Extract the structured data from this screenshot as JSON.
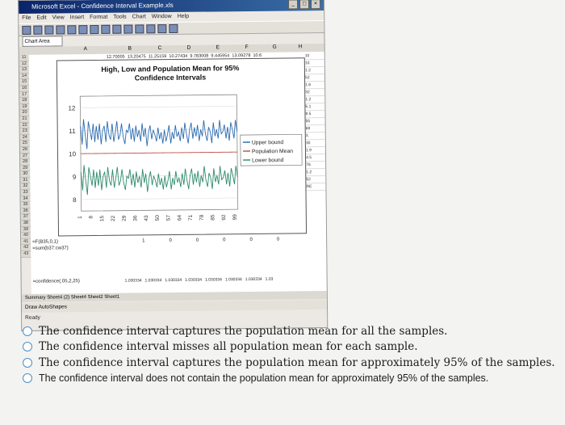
{
  "window": {
    "title": "Microsoft Excel - Confidence Interval Example.xls",
    "menu": [
      "File",
      "Edit",
      "View",
      "Insert",
      "Format",
      "Tools",
      "Chart",
      "Window",
      "Help"
    ],
    "name_box": "Chart Area"
  },
  "sheet": {
    "columns": [
      "A",
      "B",
      "C",
      "D",
      "E",
      "F",
      "G",
      "H"
    ],
    "rows": [
      "11",
      "12",
      "13",
      "14",
      "15",
      "16",
      "17",
      "18",
      "19",
      "20",
      "21",
      "22",
      "23",
      "24",
      "25",
      "26",
      "27",
      "28",
      "29",
      "30",
      "31",
      "32",
      "33",
      "34",
      "35",
      "36",
      "37",
      "38",
      "39",
      "40",
      "41",
      "42",
      "43"
    ],
    "row11_values": [
      "12.70005",
      "13.20475",
      "11.25159",
      "10.27434",
      "9.783008",
      "9.445954",
      "13.09278",
      "10.6"
    ],
    "right_col_values": [
      "10",
      "10.",
      "1.2",
      "52",
      "1.6",
      "32",
      "1.2",
      "5.1",
      "8.5",
      "55",
      "68",
      "3.",
      "30",
      "1.9",
      "4.5",
      "76",
      "1.2",
      "52",
      "RE"
    ],
    "row37": {
      "label": "=F(B35,0,1)",
      "values": [
        "1",
        "0",
        "0",
        "0",
        "0",
        "0"
      ]
    },
    "row38": {
      "label": "=sum(b37:cw37)"
    },
    "row42": {
      "label": "=confidence(.05,2,25)",
      "values": [
        "1.030334",
        "1.030334",
        "1.030334",
        "1.030334",
        "1.030334",
        "1.030334",
        "1.030334",
        "1.03"
      ]
    },
    "tabs": "Summary  Sheet4 (2)  Sheet4  Sheet2  Sheet1",
    "draw_bar": "Draw  AutoShapes",
    "status": "Ready"
  },
  "chart_data": {
    "type": "line",
    "title": "High, Low and Population Mean for 95% Confidence Intervals",
    "xlabel": "",
    "ylabel": "",
    "ylim": [
      7.5,
      12.5
    ],
    "yticks": [
      8,
      9,
      10,
      11,
      12
    ],
    "xticks": [
      "1",
      "8",
      "15",
      "22",
      "29",
      "36",
      "43",
      "50",
      "57",
      "64",
      "71",
      "78",
      "85",
      "92",
      "99"
    ],
    "x": [
      1,
      2,
      3,
      4,
      5,
      6,
      7,
      8,
      9,
      10,
      11,
      12,
      13,
      14,
      15,
      16,
      17,
      18,
      19,
      20,
      21,
      22,
      23,
      24,
      25,
      26,
      27,
      28,
      29,
      30,
      31,
      32,
      33,
      34,
      35,
      36,
      37,
      38,
      39,
      40,
      41,
      42,
      43,
      44,
      45,
      46,
      47,
      48,
      49,
      50,
      51,
      52,
      53,
      54,
      55,
      56,
      57,
      58,
      59,
      60,
      61,
      62,
      63,
      64,
      65,
      66,
      67,
      68,
      69,
      70,
      71,
      72,
      73,
      74,
      75,
      76,
      77,
      78,
      79,
      80,
      81,
      82,
      83,
      84,
      85,
      86,
      87,
      88,
      89,
      90,
      91,
      92,
      93,
      94,
      95,
      96,
      97,
      98,
      99,
      100
    ],
    "series": [
      {
        "name": "Upper bound",
        "color": "#2a6ab0",
        "values": [
          11.2,
          10.4,
          11.5,
          10.8,
          10.2,
          11.4,
          11.0,
          10.6,
          11.3,
          10.5,
          11.2,
          10.6,
          11.3,
          10.4,
          11.0,
          11.2,
          10.5,
          11.4,
          10.8,
          10.6,
          11.3,
          10.5,
          10.9,
          11.4,
          10.6,
          10.8,
          11.3,
          10.7,
          10.4,
          11.0,
          10.9,
          11.3,
          10.6,
          11.1,
          10.5,
          11.2,
          10.7,
          11.0,
          10.5,
          11.3,
          10.7,
          11.1,
          10.3,
          10.9,
          11.2,
          10.6,
          11.0,
          10.8,
          10.5,
          11.1,
          10.6,
          10.9,
          10.4,
          11.0,
          10.5,
          10.8,
          11.2,
          10.4,
          10.9,
          10.6,
          11.2,
          10.7,
          10.9,
          10.5,
          11.1,
          10.6,
          11.3,
          10.8,
          10.4,
          11.0,
          11.3,
          10.6,
          11.1,
          10.7,
          11.2,
          10.5,
          11.0,
          10.7,
          11.4,
          10.8,
          10.5,
          11.1,
          10.9,
          10.4,
          11.3,
          10.7,
          11.0,
          10.6,
          11.4,
          10.8,
          10.9,
          11.2,
          10.6,
          11.1,
          10.5,
          11.3,
          11.0,
          10.6,
          11.4,
          10.9
        ]
      },
      {
        "name": "Population Mean",
        "color": "#c0504d",
        "values": [
          10,
          10,
          10,
          10,
          10,
          10,
          10,
          10,
          10,
          10,
          10,
          10,
          10,
          10,
          10,
          10,
          10,
          10,
          10,
          10,
          10,
          10,
          10,
          10,
          10,
          10,
          10,
          10,
          10,
          10,
          10,
          10,
          10,
          10,
          10,
          10,
          10,
          10,
          10,
          10,
          10,
          10,
          10,
          10,
          10,
          10,
          10,
          10,
          10,
          10,
          10,
          10,
          10,
          10,
          10,
          10,
          10,
          10,
          10,
          10,
          10,
          10,
          10,
          10,
          10,
          10,
          10,
          10,
          10,
          10,
          10,
          10,
          10,
          10,
          10,
          10,
          10,
          10,
          10,
          10,
          10,
          10,
          10,
          10,
          10,
          10,
          10,
          10,
          10,
          10,
          10,
          10,
          10,
          10,
          10,
          10,
          10,
          10,
          10,
          10
        ]
      },
      {
        "name": "Lower bound",
        "color": "#2e8b6a",
        "values": [
          9.2,
          8.4,
          9.5,
          8.8,
          8.2,
          9.4,
          9.0,
          8.6,
          9.3,
          8.5,
          9.2,
          8.6,
          9.3,
          8.4,
          9.0,
          9.2,
          8.5,
          9.4,
          8.8,
          8.6,
          9.3,
          8.5,
          8.9,
          9.4,
          8.6,
          8.8,
          9.3,
          8.7,
          8.4,
          9.0,
          8.9,
          9.3,
          8.6,
          9.1,
          8.5,
          9.2,
          8.7,
          9.0,
          8.5,
          9.3,
          8.7,
          9.1,
          8.3,
          8.9,
          9.2,
          8.6,
          9.0,
          8.8,
          8.5,
          9.1,
          8.6,
          8.9,
          8.4,
          9.0,
          8.5,
          8.8,
          9.2,
          8.4,
          8.9,
          8.6,
          9.2,
          8.7,
          8.9,
          8.5,
          9.1,
          8.6,
          9.3,
          8.8,
          8.4,
          9.0,
          9.3,
          8.6,
          9.1,
          8.7,
          9.2,
          8.5,
          9.0,
          8.7,
          9.4,
          8.8,
          8.5,
          9.1,
          8.9,
          8.4,
          9.3,
          8.7,
          9.0,
          8.6,
          9.4,
          8.8,
          8.9,
          9.2,
          8.6,
          9.1,
          8.5,
          9.3,
          9.0,
          8.6,
          9.4,
          8.9
        ]
      }
    ],
    "legend": "right"
  },
  "question": {
    "options": [
      "The confidence interval captures the population mean for all the samples.",
      "The confidence interval misses all population mean for each sample.",
      "The confidence interval captures the population mean for approximately 95% of the samples.",
      "The confidence interval does not contain the population mean for approximately 95% of the samples."
    ]
  }
}
